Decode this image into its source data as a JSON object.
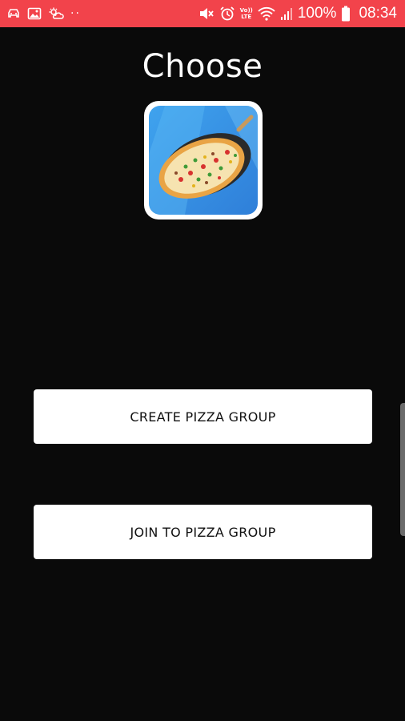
{
  "status_bar": {
    "notification_dots": "··",
    "volte_top": "Vo))",
    "volte_bottom": "LTE",
    "battery_percent": "100%",
    "time": "08:34",
    "background_color": "#f2434b",
    "icons": [
      "car-icon",
      "image-icon",
      "weather-icon",
      "mute-icon",
      "alarm-icon",
      "volte-icon",
      "wifi-icon",
      "signal-icon",
      "battery-icon"
    ]
  },
  "screen": {
    "title": "Choose",
    "logo_icon": "pizza-app-icon"
  },
  "actions": {
    "create_label": "CREATE PIZZA GROUP",
    "join_label": "JOIN TO PIZZA GROUP"
  }
}
